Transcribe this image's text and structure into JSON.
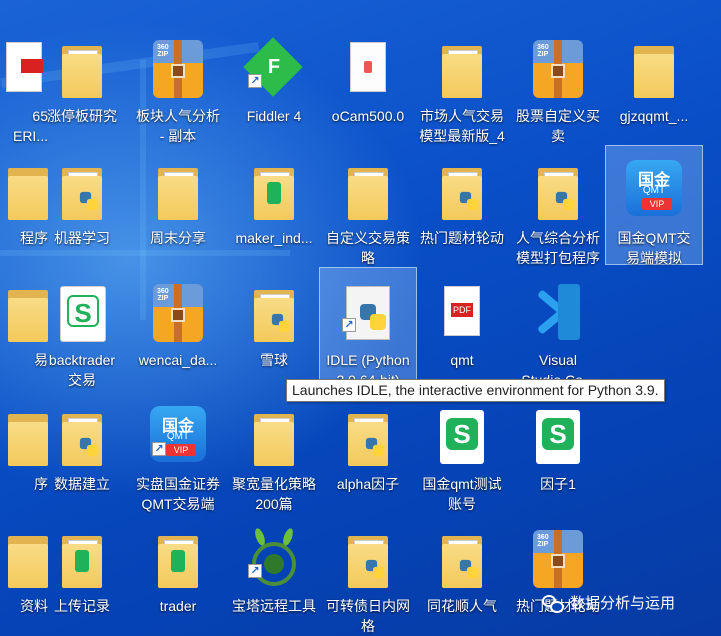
{
  "desktop": {
    "icons": {
      "r1c0": {
        "label": "65\nERI..."
      },
      "r1c1": {
        "label": "涨停板研究"
      },
      "r1c2": {
        "label": "板块人气分析\n- 副本"
      },
      "r1c3": {
        "label": "Fiddler 4"
      },
      "r1c4": {
        "label": "oCam500.0"
      },
      "r1c5": {
        "label": "市场人气交易\n模型最新版_4"
      },
      "r1c6": {
        "label": "股票自定义买\n卖"
      },
      "r1c7": {
        "label": "gjzqqmt_..."
      },
      "r2c0": {
        "label": "程序"
      },
      "r2c1": {
        "label": "机器学习"
      },
      "r2c2": {
        "label": "周末分享"
      },
      "r2c3": {
        "label": "maker_ind..."
      },
      "r2c4": {
        "label": "自定义交易策\n略"
      },
      "r2c5": {
        "label": "热门题材轮动"
      },
      "r2c6": {
        "label": "人气综合分析\n模型打包程序"
      },
      "r2c7": {
        "label": "国金QMT交\n易端模拟"
      },
      "r3c0": {
        "label": "易"
      },
      "r3c1": {
        "label": "backtrader\n交易"
      },
      "r3c2": {
        "label": "wencai_da..."
      },
      "r3c3": {
        "label": "雪球"
      },
      "r3c4": {
        "label": "IDLE (Python\n3.9 64-bit)"
      },
      "r3c5": {
        "label": "qmt"
      },
      "r3c6": {
        "label": "Visual\nStudio Co..."
      },
      "r4c0": {
        "label": "序"
      },
      "r4c1": {
        "label": "数据建立"
      },
      "r4c2": {
        "label": "实盘国金证券\nQMT交易端"
      },
      "r4c3": {
        "label": "聚宽量化策略\n200篇"
      },
      "r4c4": {
        "label": "alpha因子"
      },
      "r4c5": {
        "label": "国金qmt测试\n账号"
      },
      "r4c6": {
        "label": "因子1"
      },
      "r5c0": {
        "label": "资料"
      },
      "r5c1": {
        "label": "上传记录"
      },
      "r5c2": {
        "label": "trader"
      },
      "r5c3": {
        "label": "宝塔远程工具"
      },
      "r5c4": {
        "label": "可转债日内网\n格"
      },
      "r5c5": {
        "label": "同花顺人气"
      },
      "r5c6": {
        "label": "热门题材轮动"
      }
    },
    "glyph_text": {
      "zip": "360\nZIP",
      "qmt_top": "国金",
      "qmt_mid": "QMT",
      "vip": "VIP",
      "fiddler": "F",
      "wps": "S",
      "pdf": "PDF",
      "shortcut_arrow": "↗"
    }
  },
  "tooltip": {
    "text": "Launches IDLE, the interactive environment for Python 3.9."
  },
  "watermark": {
    "text": "数据分析与运用"
  },
  "colors": {
    "desktop_bg": "#0a4fc8",
    "folder": "#f3c95b",
    "tooltip_bg": "#ffffff"
  }
}
